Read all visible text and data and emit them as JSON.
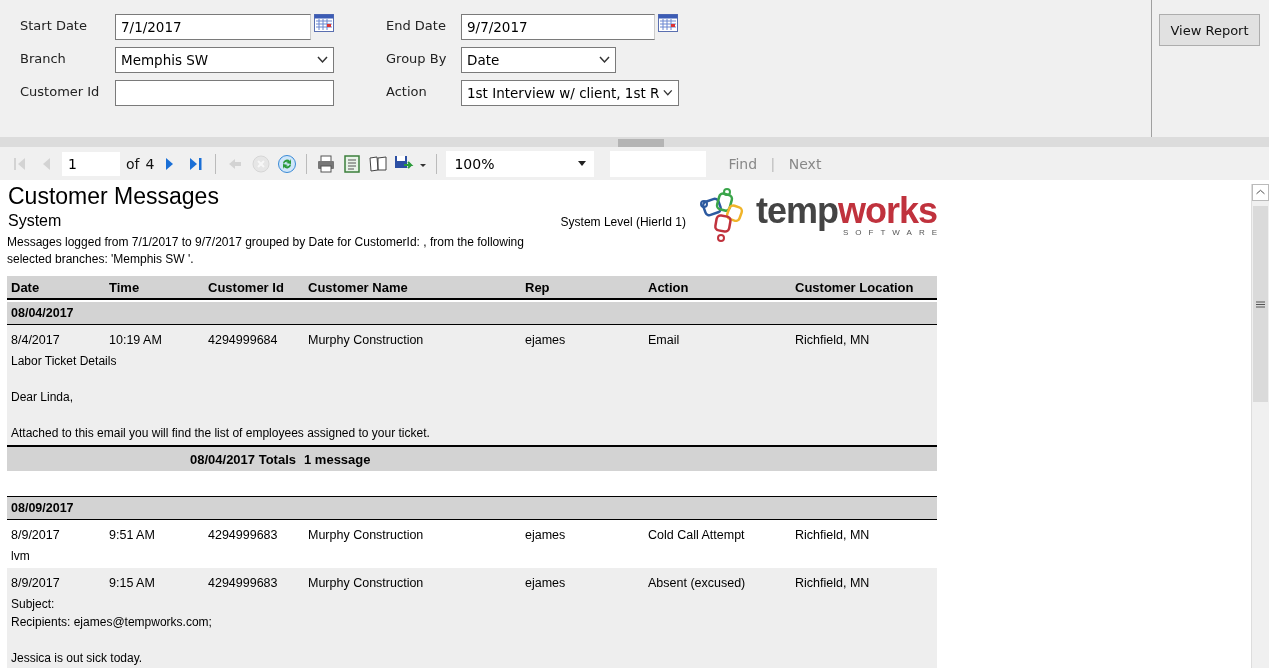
{
  "params": [
    {
      "kind": "date",
      "label": "Start Date",
      "value": "7/1/2017"
    },
    {
      "kind": "date",
      "label": "End Date",
      "value": "9/7/2017"
    },
    {
      "kind": "select",
      "label": "Branch",
      "value": "Memphis SW"
    },
    {
      "kind": "select",
      "label": "Group By",
      "value": "Date"
    },
    {
      "kind": "text",
      "label": "Customer Id"
    },
    {
      "kind": "select",
      "label": "Action",
      "value": "1st Interview w/ client, 1st R"
    }
  ],
  "view_report": "View Report",
  "toolbar": {
    "buttons": [
      {
        "kind": "first",
        "disabled": true
      },
      {
        "kind": "prev",
        "disabled": true
      },
      {
        "kind": "page"
      },
      {
        "kind": "next",
        "disabled": false
      },
      {
        "kind": "last",
        "disabled": false
      },
      {
        "kind": "sep"
      },
      {
        "kind": "back",
        "disabled": true
      },
      {
        "kind": "stop",
        "disabled": true
      },
      {
        "kind": "refresh",
        "disabled": false
      },
      {
        "kind": "sep"
      },
      {
        "kind": "print",
        "disabled": false
      },
      {
        "kind": "layout",
        "disabled": false
      },
      {
        "kind": "setup",
        "disabled": false
      },
      {
        "kind": "export",
        "disabled": false
      },
      {
        "kind": "sep"
      }
    ],
    "page": "1",
    "of": "of",
    "total": "4",
    "zoom": "100%",
    "find": "Find",
    "divider": "|",
    "next": "Next"
  },
  "report": {
    "title": "Customer Messages",
    "subtitle": "System",
    "level": "System Level (HierId 1)",
    "description": [
      "Messages logged from 7/1/2017 to 9/7/2017 grouped by Date  for CustomerId: , from the following",
      "selected branches: 'Memphis SW '."
    ],
    "logo": {
      "first": "temp",
      "second": "works",
      "tagline": "SOFTWARE"
    },
    "columns": [
      "Date",
      "Time",
      "Customer Id",
      "Customer Name",
      "Rep",
      "Action",
      "Customer Location"
    ],
    "groups": [
      {
        "label": "08/04/2017",
        "messages": [
          {
            "shaded": true,
            "cells": [
              "8/4/2017",
              "10:19 AM",
              "4294999684",
              "Murphy Construction",
              "ejames",
              "Email",
              "Richfield, MN"
            ],
            "paragraphs": [
              [
                "Labor Ticket Details"
              ],
              [
                "Dear Linda,"
              ],
              [
                "Attached to this email you will find the list of employees assigned to your ticket."
              ]
            ]
          }
        ],
        "totals": {
          "label": "08/04/2017 Totals",
          "count": "1 message"
        }
      },
      {
        "label": "08/09/2017",
        "messages": [
          {
            "shaded": false,
            "cells": [
              "8/9/2017",
              "9:51 AM",
              "4294999683",
              "Murphy Construction",
              "ejames",
              "Cold Call Attempt",
              "Richfield, MN"
            ],
            "paragraphs": [
              [
                "lvm"
              ]
            ]
          },
          {
            "shaded": true,
            "cells": [
              "8/9/2017",
              "9:15 AM",
              "4294999683",
              "Murphy Construction",
              "ejames",
              "Absent (excused)",
              "Richfield, MN"
            ],
            "paragraphs": [
              [
                "Subject:",
                "Recipients: ejames@tempworks.com;"
              ],
              [
                "Jessica is out sick today."
              ]
            ]
          }
        ]
      }
    ]
  }
}
